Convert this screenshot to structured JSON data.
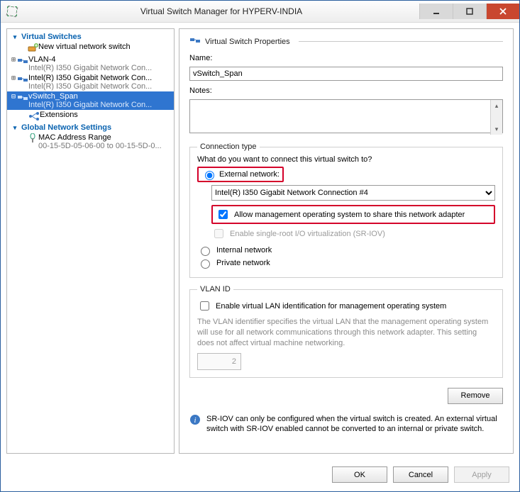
{
  "window": {
    "title": "Virtual Switch Manager for HYPERV-INDIA",
    "buttons": {
      "minimize": "–",
      "maximize": "□",
      "close": "✕"
    }
  },
  "tree": {
    "section_switches": "Virtual Switches",
    "section_global": "Global Network Settings",
    "new_switch": "New virtual network switch",
    "items": [
      {
        "name": "VLAN-4",
        "sub": "Intel(R) I350 Gigabit Network Con..."
      },
      {
        "name": "Intel(R) I350 Gigabit Network Con...",
        "sub": "Intel(R) I350 Gigabit Network Con..."
      },
      {
        "name": "vSwitch_Span",
        "sub": "Intel(R) I350 Gigabit Network Con..."
      }
    ],
    "extensions": "Extensions",
    "mac": {
      "name": "MAC Address Range",
      "sub": "00-15-5D-05-06-00 to 00-15-5D-0..."
    }
  },
  "props": {
    "heading": "Virtual Switch Properties",
    "name_label": "Name:",
    "name_value": "vSwitch_Span",
    "notes_label": "Notes:",
    "notes_value": "",
    "conn": {
      "legend": "Connection type",
      "question": "What do you want to connect this virtual switch to?",
      "external": "External network:",
      "adapter_selected": "Intel(R) I350 Gigabit Network Connection #4",
      "allow_mgmt": "Allow management operating system to share this network adapter",
      "sriov": "Enable single-root I/O virtualization (SR-IOV)",
      "internal": "Internal network",
      "private": "Private network"
    },
    "vlan": {
      "legend": "VLAN ID",
      "enable": "Enable virtual LAN identification for management operating system",
      "help": "The VLAN identifier specifies the virtual LAN that the management operating system will use for all network communications through this network adapter. This setting does not affect virtual machine networking.",
      "value": "2"
    },
    "remove": "Remove",
    "sriov_info": "SR-IOV can only be configured when the virtual switch is created. An external virtual switch with SR-IOV enabled cannot be converted to an internal or private switch."
  },
  "footer": {
    "ok": "OK",
    "cancel": "Cancel",
    "apply": "Apply"
  }
}
